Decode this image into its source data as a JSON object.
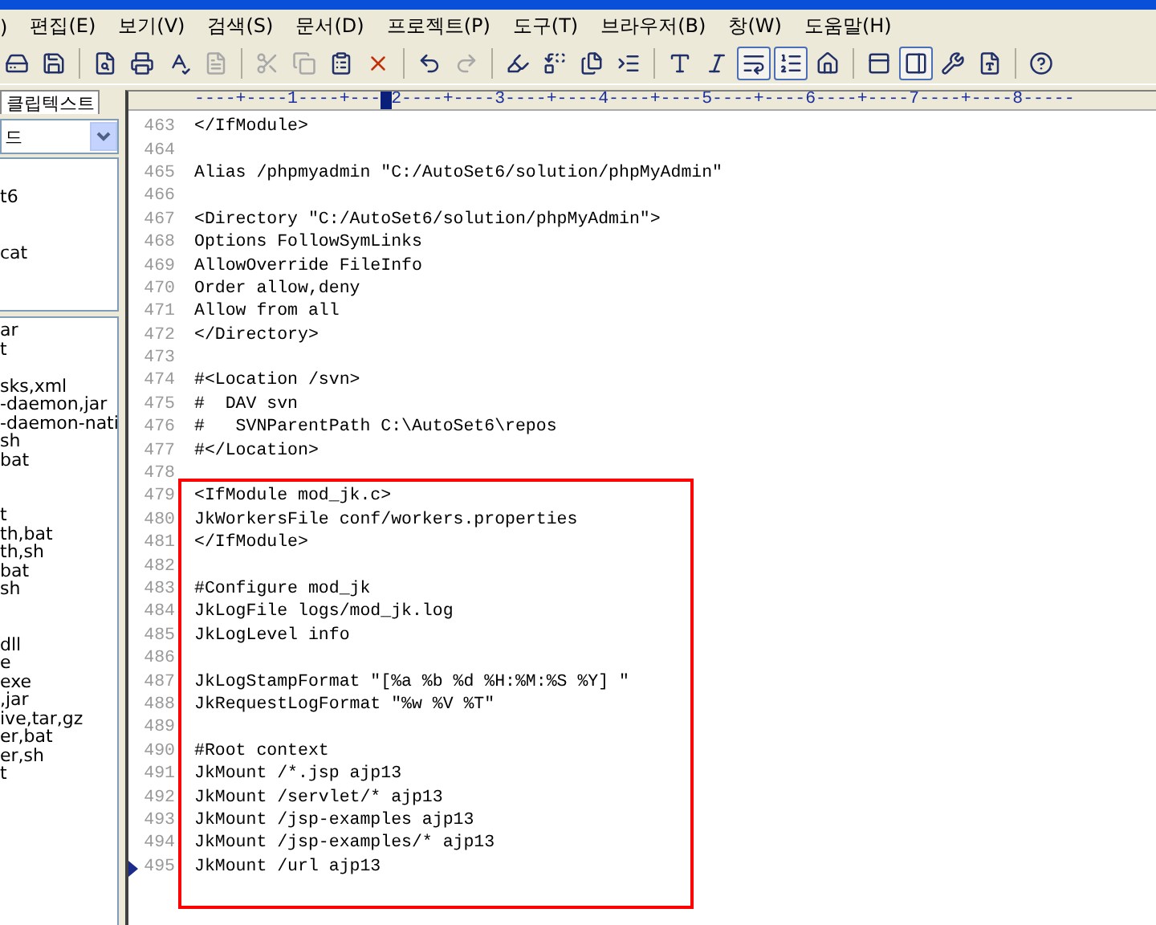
{
  "menu": [
    {
      "label": ")"
    },
    {
      "label": "편집(E)"
    },
    {
      "label": "보기(V)"
    },
    {
      "label": "검색(S)"
    },
    {
      "label": "문서(D)"
    },
    {
      "label": "프로젝트(P)"
    },
    {
      "label": "도구(T)"
    },
    {
      "label": "브라우저(B)"
    },
    {
      "label": "창(W)"
    },
    {
      "label": "도움말(H)"
    }
  ],
  "toolbar": [
    {
      "kind": "button",
      "disabled": false,
      "selected": false
    },
    {
      "kind": "button",
      "disabled": false,
      "selected": false
    },
    {
      "kind": "separator"
    },
    {
      "kind": "button",
      "disabled": false,
      "selected": false
    },
    {
      "kind": "button",
      "disabled": false,
      "selected": false
    },
    {
      "kind": "button",
      "disabled": false,
      "selected": false
    },
    {
      "kind": "button",
      "disabled": true,
      "selected": false
    },
    {
      "kind": "separator"
    },
    {
      "kind": "button",
      "disabled": true,
      "selected": false
    },
    {
      "kind": "button",
      "disabled": true,
      "selected": false
    },
    {
      "kind": "button",
      "disabled": false,
      "selected": false
    },
    {
      "kind": "button",
      "disabled": false,
      "selected": false
    },
    {
      "kind": "separator"
    },
    {
      "kind": "button",
      "disabled": false,
      "selected": false
    },
    {
      "kind": "button",
      "disabled": true,
      "selected": false
    },
    {
      "kind": "separator"
    },
    {
      "kind": "button",
      "disabled": false,
      "selected": false
    },
    {
      "kind": "button",
      "disabled": false,
      "selected": false
    },
    {
      "kind": "button",
      "disabled": false,
      "selected": false
    },
    {
      "kind": "button",
      "disabled": false,
      "selected": false
    },
    {
      "kind": "separator"
    },
    {
      "kind": "button",
      "disabled": false,
      "selected": false
    },
    {
      "kind": "button",
      "disabled": false,
      "selected": false
    },
    {
      "kind": "button",
      "disabled": false,
      "selected": true
    },
    {
      "kind": "button",
      "disabled": false,
      "selected": true
    },
    {
      "kind": "button",
      "disabled": false,
      "selected": false
    },
    {
      "kind": "separator"
    },
    {
      "kind": "button",
      "disabled": false,
      "selected": false
    },
    {
      "kind": "button",
      "disabled": false,
      "selected": true
    },
    {
      "kind": "button",
      "disabled": false,
      "selected": false
    },
    {
      "kind": "button",
      "disabled": false,
      "selected": false
    },
    {
      "kind": "separator"
    },
    {
      "kind": "button",
      "disabled": false,
      "selected": false
    }
  ],
  "sidebar": {
    "tab": "클립텍스트",
    "dropdown": "드",
    "upper_list": [
      {
        "kind": "item",
        "text": "t6"
      },
      {
        "kind": "blank"
      },
      {
        "kind": "blank"
      },
      {
        "kind": "item",
        "text": "cat"
      }
    ],
    "lower_list": [
      {
        "kind": "item",
        "text": "ar"
      },
      {
        "kind": "item",
        "text": "t"
      },
      {
        "kind": "blank"
      },
      {
        "kind": "item",
        "text": "sks,xml"
      },
      {
        "kind": "item",
        "text": "-daemon,jar"
      },
      {
        "kind": "item",
        "text": "-daemon-nati"
      },
      {
        "kind": "item",
        "text": "sh"
      },
      {
        "kind": "item",
        "text": "bat"
      },
      {
        "kind": "blank"
      },
      {
        "kind": "blank"
      },
      {
        "kind": "item",
        "text": "t"
      },
      {
        "kind": "item",
        "text": "th,bat"
      },
      {
        "kind": "item",
        "text": "th,sh"
      },
      {
        "kind": "item",
        "text": "bat"
      },
      {
        "kind": "item",
        "text": "sh"
      },
      {
        "kind": "blank"
      },
      {
        "kind": "blank"
      },
      {
        "kind": "item",
        "text": "dll"
      },
      {
        "kind": "item",
        "text": "e"
      },
      {
        "kind": "item",
        "text": "exe"
      },
      {
        "kind": "item",
        "text": ",jar"
      },
      {
        "kind": "item",
        "text": "ive,tar,gz"
      },
      {
        "kind": "item",
        "text": "er,bat"
      },
      {
        "kind": "item",
        "text": "er,sh"
      },
      {
        "kind": "item",
        "text": "t"
      }
    ]
  },
  "ruler": {
    "before": "----+----1----+---",
    "after": "2----+----3----+----4----+----5----+----6----+----7----+----8-----"
  },
  "code_blocks": [
    {
      "boxed": false,
      "lines": [
        {
          "number": "463",
          "text": "</IfModule>",
          "current": false
        },
        {
          "number": "464",
          "current": false
        },
        {
          "number": "465",
          "text": "Alias /phpmyadmin \"C:/AutoSet6/solution/phpMyAdmin\"",
          "current": false
        },
        {
          "number": "466",
          "current": false
        },
        {
          "number": "467",
          "text": "<Directory \"C:/AutoSet6/solution/phpMyAdmin\">",
          "current": false
        },
        {
          "number": "468",
          "text": "Options FollowSymLinks",
          "current": false
        },
        {
          "number": "469",
          "text": "AllowOverride FileInfo",
          "current": false
        },
        {
          "number": "470",
          "text": "Order allow,deny",
          "current": false
        },
        {
          "number": "471",
          "text": "Allow from all",
          "current": false
        },
        {
          "number": "472",
          "text": "</Directory>",
          "current": false
        },
        {
          "number": "473",
          "current": false
        },
        {
          "number": "474",
          "text": "#<Location /svn>",
          "current": false
        },
        {
          "number": "475",
          "text": "#  DAV svn",
          "current": false
        },
        {
          "number": "476",
          "text": "#   SVNParentPath C:\\AutoSet6\\repos",
          "current": false
        },
        {
          "number": "477",
          "text": "#</Location>",
          "current": false
        },
        {
          "number": "478",
          "current": false
        }
      ]
    },
    {
      "boxed": true,
      "lines": [
        {
          "number": "479",
          "text": "<IfModule mod_jk.c>",
          "current": false
        },
        {
          "number": "480",
          "text": "JkWorkersFile conf/workers.properties",
          "current": false
        },
        {
          "number": "481",
          "text": "</IfModule>",
          "current": false
        },
        {
          "number": "482",
          "current": false
        },
        {
          "number": "483",
          "text": "#Configure mod_jk",
          "current": false
        },
        {
          "number": "484",
          "text": "JkLogFile logs/mod_jk.log",
          "current": false
        },
        {
          "number": "485",
          "text": "JkLogLevel info",
          "current": false
        },
        {
          "number": "486",
          "current": false
        },
        {
          "number": "487",
          "text": "JkLogStampFormat \"[%a %b %d %H:%M:%S %Y] \"",
          "current": false
        },
        {
          "number": "488",
          "text": "JkRequestLogFormat \"%w %V %T\"",
          "current": false
        },
        {
          "number": "489",
          "current": false
        },
        {
          "number": "490",
          "text": "#Root context",
          "current": false
        },
        {
          "number": "491",
          "text": "JkMount /*.jsp ajp13",
          "current": false
        },
        {
          "number": "492",
          "text": "JkMount /servlet/* ajp13",
          "current": false
        },
        {
          "number": "493",
          "text": "JkMount /jsp-examples ajp13",
          "current": false
        },
        {
          "number": "494",
          "text": "JkMount /jsp-examples/* ajp13",
          "current": false
        },
        {
          "number": "495",
          "text": "JkMount /url ajp13",
          "current": true
        }
      ]
    }
  ]
}
